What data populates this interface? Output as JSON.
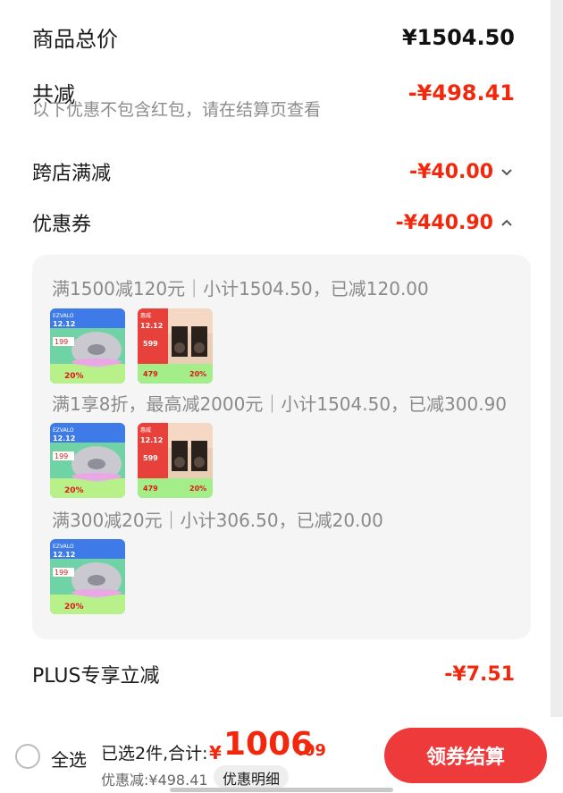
{
  "summary": {
    "total_label": "商品总价",
    "total_value": "¥1504.50",
    "reduce_label": "共减",
    "reduce_value": "-¥498.41",
    "reduce_note": "以下优惠不包含红包，请在结算页查看",
    "cross_store_label": "跨店满减",
    "cross_store_value": "-¥40.00",
    "coupon_label": "优惠券",
    "coupon_value": "-¥440.90",
    "plus_label": "PLUS专享立减",
    "plus_value": "-¥7.51"
  },
  "coupon_rules": [
    {
      "text": "满1500减120元｜小计1504.50，已减120.00"
    },
    {
      "text": "满1享8折，最高减2000元｜小计1504.50，已减300.90"
    },
    {
      "text": "满300减20元｜小计306.50，已减20.00"
    }
  ],
  "products": {
    "aroma": {
      "brand": "EZVALO",
      "promo": "12.12 年末大促",
      "price": "199",
      "pct": "20%"
    },
    "speaker": {
      "brand": "惠威",
      "promo": "12.12 年末大促",
      "price": "599",
      "price2": "479",
      "pct": "20%"
    }
  },
  "bottom_bar": {
    "select_all": "全选",
    "selected_count": "已选2件,合计:",
    "currency": "¥",
    "total_int": "1006",
    "total_dec": ".09",
    "discount_text": "优惠减:¥498.41",
    "detail_button": "优惠明细",
    "checkout_button": "领券结算"
  },
  "colors": {
    "accent_red": "#f2270c",
    "button_red": "#ee3a3a"
  },
  "icons": {
    "expand": "chevron-down-icon",
    "collapse": "chevron-up-icon"
  }
}
